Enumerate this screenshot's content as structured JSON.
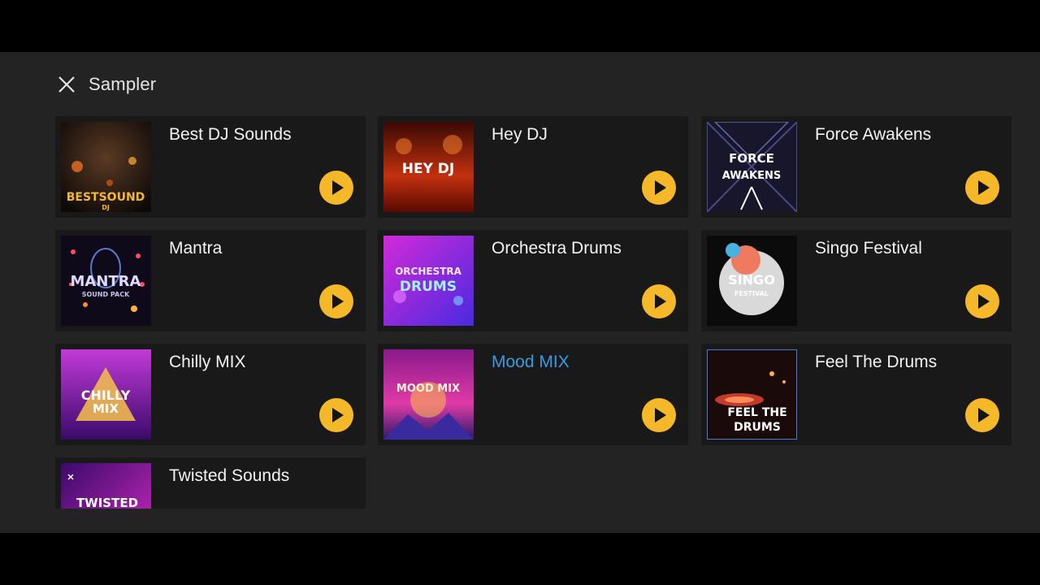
{
  "header": {
    "title": "Sampler",
    "close_icon": "close-icon"
  },
  "colors": {
    "panel_bg": "#232323",
    "card_bg": "#191919",
    "play_button": "#f5b829",
    "active_title": "#3b9be0"
  },
  "packs": [
    {
      "title": "Best DJ Sounds",
      "cover_text": "BESTSOUND",
      "cover_subtext": "DJ",
      "active": false
    },
    {
      "title": "Hey DJ",
      "cover_text": "HEY DJ",
      "cover_subtext": "",
      "active": false
    },
    {
      "title": "Force Awakens",
      "cover_text": "FORCE",
      "cover_subtext": "AWAKENS",
      "active": false
    },
    {
      "title": "Mantra",
      "cover_text": "MANTRA",
      "cover_subtext": "SOUND PACK",
      "active": false
    },
    {
      "title": "Orchestra Drums",
      "cover_text": "ORCHESTRA",
      "cover_subtext": "DRUMS",
      "active": false
    },
    {
      "title": "Singo Festival",
      "cover_text": "SINGO",
      "cover_subtext": "FESTIVAL",
      "active": false
    },
    {
      "title": "Chilly MIX",
      "cover_text": "CHILLY",
      "cover_subtext": "MIX",
      "active": false
    },
    {
      "title": "Mood MIX",
      "cover_text": "MOOD MIX",
      "cover_subtext": "",
      "active": true
    },
    {
      "title": "Feel The Drums",
      "cover_text": "FEEL THE",
      "cover_subtext": "DRUMS",
      "active": false
    },
    {
      "title": "Twisted Sounds",
      "cover_text": "TWISTED",
      "cover_subtext": "",
      "active": false
    }
  ]
}
